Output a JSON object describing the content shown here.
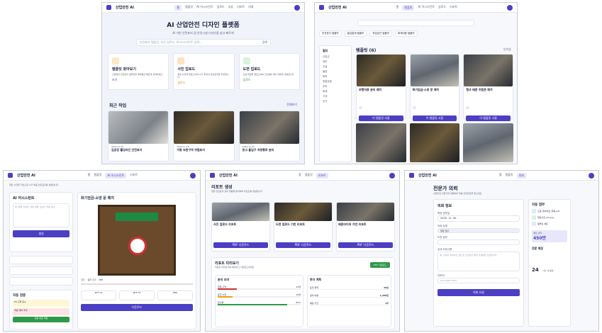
{
  "app": {
    "name": "산업안전 AI"
  },
  "nav": {
    "home": "홈",
    "templates": "템플릿",
    "ai_assistant": "AI 어시스턴트",
    "upload": "업로드",
    "review": "리뷰",
    "report": "리포트",
    "request": "의뢰"
  },
  "p1": {
    "hero_title": "AI 산업안전 디자인 플랫폼",
    "hero_sub": "AI 기반 안전표지 및 안전시설 디자인을 쉽고 빠르게",
    "search_placeholder": "안전표지 템플릿, 사진 업로드, AI 어시스턴트 검색...",
    "search_btn": "검색",
    "cards": [
      {
        "title": "템플릿 찾아보기",
        "desc": "산업현장 안전표지 템플릿을 목적별로 빠르게 검색하세요",
        "link": "보기"
      },
      {
        "title": "사진 업로드",
        "desc": "현장 사진을 업로드하여 AI가 최적의 안전표지를 추천합니다",
        "link": "업로드"
      },
      {
        "title": "도면 업로드",
        "desc": "도면 파일을 업로드하여 안전설비 배치 계획을 생성합니다",
        "link": "업로드"
      }
    ],
    "recent_title": "최근 작업",
    "recent_more": "전체보기",
    "recent": [
      {
        "date": "2024.11.20",
        "title": "김공장 웰딩라인 안전표지"
      },
      {
        "date": "2024.11.18",
        "title": "이형 보관구역 위험표지"
      },
      {
        "date": "2024.11.15",
        "title": "창고 출입구 차량통로 분리"
      }
    ]
  },
  "p2": {
    "tabs": [
      "안전표지 템플릿",
      "출입통제 템플릿",
      "작업공간 템플릿",
      "화재대응 템플릿"
    ],
    "filter_title": "필터",
    "result_title": "템플릿 (6)",
    "sort": "인기순",
    "items": [
      {
        "title": "보행자용 분리 패치",
        "btn": "이 템플릿 사용"
      },
      {
        "title": "화기엄금-소방 문 패치",
        "btn": "이 템플릿 사용"
      },
      {
        "title": "탱크 배관 위험존 패치",
        "btn": "이 템플릿 사용"
      }
    ],
    "filters": [
      "산업군",
      "제조",
      "건설",
      "물류",
      "화학",
      "위험유형",
      "추락",
      "화재",
      "기계",
      "전기"
    ]
  },
  "p3": {
    "title": "AI 어시스턴트",
    "crumb": "현장 사진을 기반으로 AI가 맞춤 안전표지를 생성합니다",
    "prompt_placeholder": "예: 용접 작업장, 화재 위험, 보호구 착용 필수...",
    "generate": "생성",
    "preview_title": "화기엄금-소방 문 패치",
    "check_title": "자동 검증",
    "check_items": [
      "KS 규격 준수",
      "색상 대비 주의",
      "법적 요구사항 충족"
    ],
    "download": "다운로드",
    "size_labels": [
      "크기",
      "글자 크기",
      "여백"
    ],
    "formats": [
      "PDF A4",
      "PDF A3",
      "PNG"
    ],
    "apply": "검증 완료 적용"
  },
  "p4": {
    "title": "리포트 생성",
    "sub": "현장 안전표지 설치 현황을 분석하여 리포트를 생성합니다",
    "cards": [
      {
        "title": "사진 업로드 리포트",
        "btn": "PDF 다운로드"
      },
      {
        "title": "도면 업로드 기반 리포트",
        "btn": "PDF 다운로드"
      },
      {
        "title": "배관라이프 기반 리포트",
        "btn": "PDF 다운로드"
      }
    ],
    "preview_title": "리포트 미리보기",
    "preview_sub": "리포트 미리보기를 확인하고 다운로드하세요",
    "pdf": "PDF 다운로드",
    "summary_title": "분석 요약",
    "bars": [
      {
        "label": "위험 구역",
        "value": 23
      },
      {
        "label": "표지 누락",
        "value": 18
      },
      {
        "label": "준수율",
        "value": 84
      }
    ],
    "bar_units": [
      "23개",
      "18개",
      "84%"
    ],
    "cost_title": "투자 계획",
    "costs": [
      {
        "k": "표지 제작",
        "v": "45만"
      },
      {
        "k": "설치 비용",
        "v": "1,250만"
      },
      {
        "k": "예상 기간",
        "v": "3주"
      }
    ]
  },
  "p5": {
    "title": "전문가 의뢰",
    "sub": "산업안전 전문가와 연결하여 맞춤 안전진단을 받으세요",
    "form_title": "의뢰 정보",
    "date_label": "희망 방문일",
    "date_value": "2025. 11. 30.",
    "type_label": "의뢰 유형",
    "type_value": "현장 진단",
    "file_label": "도면 첨부",
    "desc_label": "상세 요청사항",
    "desc_placeholder": "예: 신공장 레이아웃 검토 및 안전표지 배치 컨설팅을 요청합니다",
    "phone_label": "연락처",
    "phone_placeholder": "010-0000-0000",
    "submit": "의뢰 요청",
    "side_title": "자동 첨부",
    "files": [
      "도면_레이아웃_최종.pdf",
      "현장사진_01.png",
      "템플릿 세트"
    ],
    "price_label": "예상 견적",
    "price": "450만",
    "expert_title": "전문 매칭",
    "days": "24",
    "days_unit": "시간 내 응답"
  }
}
